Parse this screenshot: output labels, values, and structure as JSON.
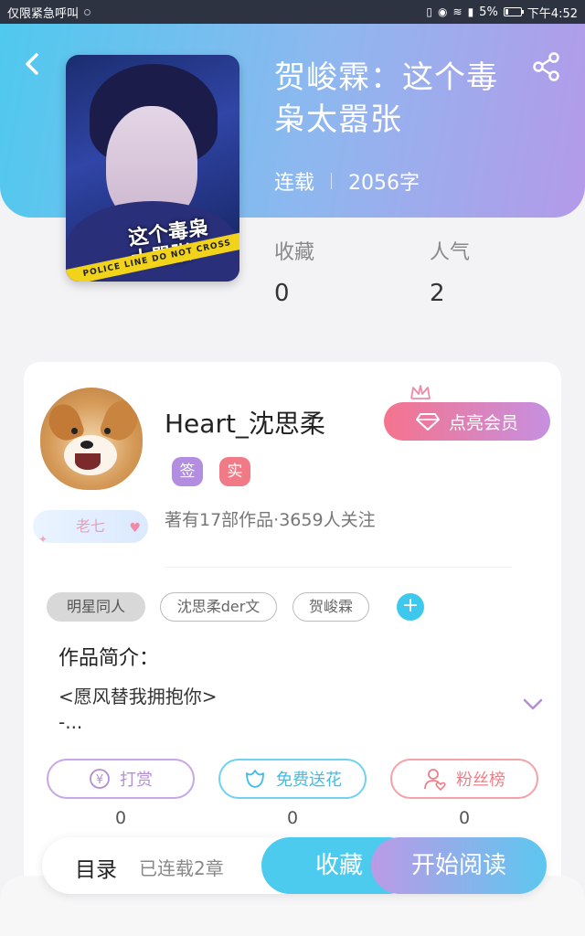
{
  "status_bar": {
    "carrier": "仅限紧急呼叫",
    "battery": "5%",
    "time": "下午4:52"
  },
  "book": {
    "title": "贺峻霖：这个毒枭太嚣张",
    "status": "连载",
    "word_count": "2056字",
    "cover_title": "这个毒枭\n太嚣张",
    "cover_tape": "POLICE LINE DO NOT CROSS"
  },
  "stats": {
    "favorites_label": "收藏",
    "favorites_value": "0",
    "popularity_label": "人气",
    "popularity_value": "2"
  },
  "author": {
    "name": "Heart_沈思柔",
    "badge_sign": "签",
    "badge_real": "实",
    "level": "老七",
    "meta": "著有17部作品·3659人关注",
    "vip_button": "点亮会员"
  },
  "tags": [
    "明星同人",
    "沈思柔der文",
    "贺峻霖"
  ],
  "intro": {
    "label": "作品简介：",
    "text": "<愿风替我拥抱你>\n-..."
  },
  "actions": [
    {
      "label": "打赏",
      "icon": "yen-icon",
      "count": "0"
    },
    {
      "label": "免费送花",
      "icon": "flower-icon",
      "count": "0"
    },
    {
      "label": "粉丝榜",
      "icon": "fans-icon",
      "count": "0"
    }
  ],
  "bottom_bar": {
    "toc": "目录",
    "chapters": "已连载2章",
    "collect": "收藏",
    "read": "开始阅读"
  },
  "colors": {
    "accent_blue": "#4fc9ee",
    "accent_purple": "#b49ae9",
    "vip_pink": "#f5738d"
  }
}
